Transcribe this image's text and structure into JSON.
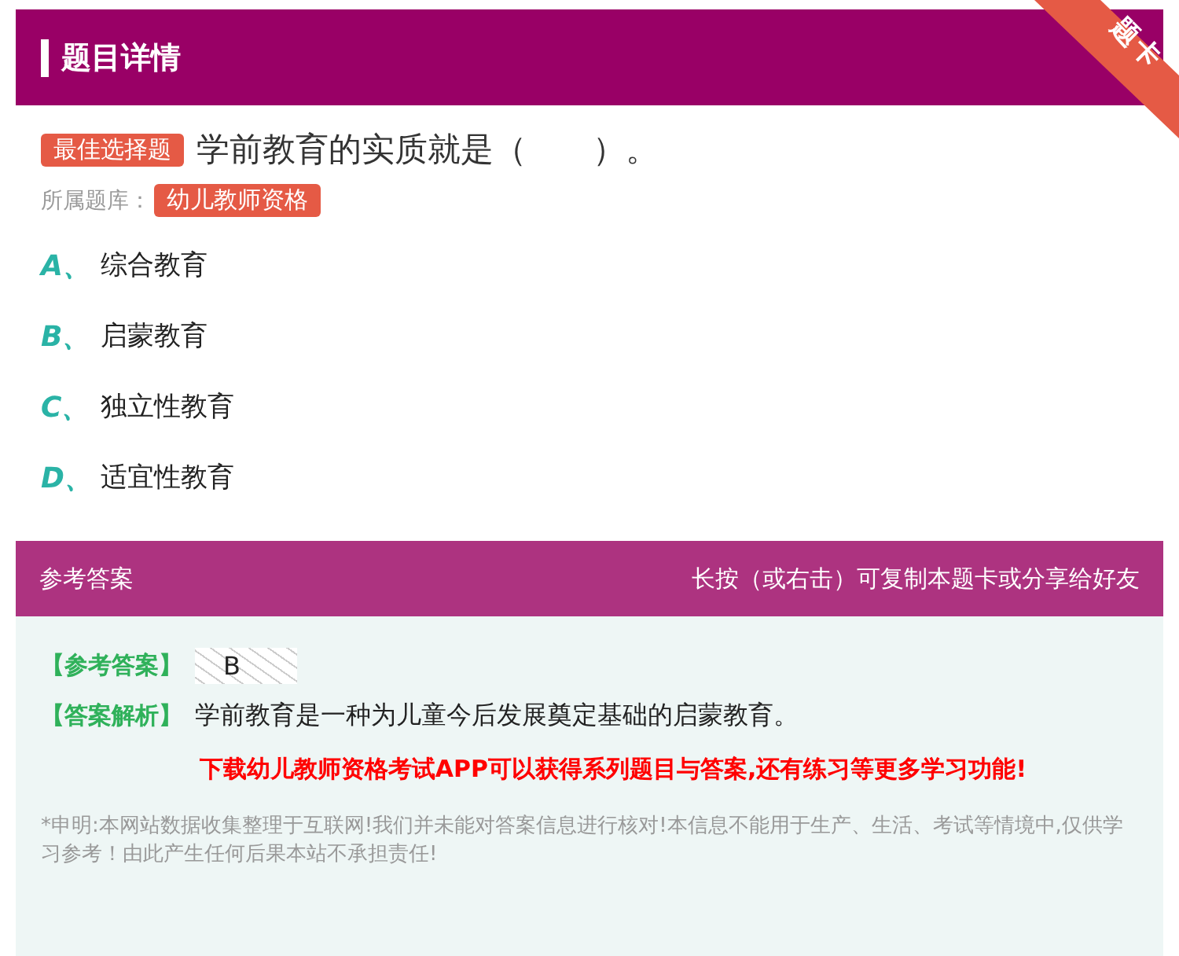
{
  "header": {
    "title": "题目详情"
  },
  "corner_ribbon": {
    "text": "题卡"
  },
  "question": {
    "type_tag": "最佳选择题",
    "text": "学前教育的实质就是（　　）。",
    "bank_label": "所属题库：",
    "bank_tag": "幼儿教师资格"
  },
  "options": [
    {
      "letter": "A、",
      "text": "综合教育"
    },
    {
      "letter": "B、",
      "text": "启蒙教育"
    },
    {
      "letter": "C、",
      "text": "独立性教育"
    },
    {
      "letter": "D、",
      "text": "适宜性教育"
    }
  ],
  "answer_panel": {
    "title": "参考答案",
    "hint": "长按（或右击）可复制本题卡或分享给好友",
    "answer_label": "【参考答案】",
    "answer": "B",
    "analysis_label": "【答案解析】",
    "analysis": "学前教育是一种为儿童今后发展奠定基础的启蒙教育。",
    "promo": "下载幼儿教师资格考试APP可以获得系列题目与答案,还有练习等更多学习功能!",
    "disclaimer": "*申明:本网站数据收集整理于互联网!我们并未能对答案信息进行核对!本信息不能用于生产、生活、考试等情境中,仅供学习参考！由此产生任何后果本站不承担责任!"
  }
}
